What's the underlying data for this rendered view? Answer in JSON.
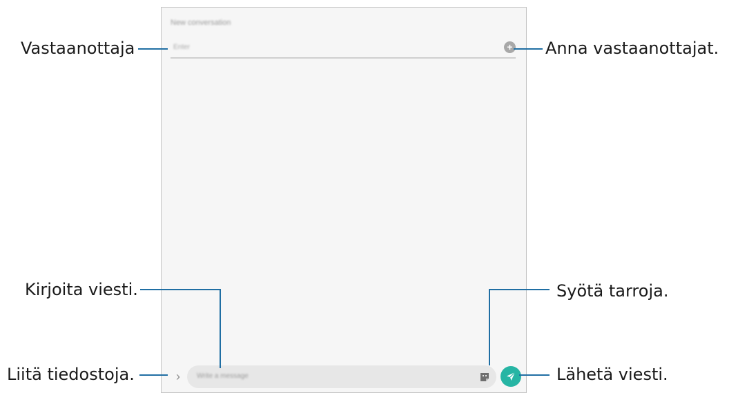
{
  "screen": {
    "title": "New conversation",
    "recipient_placeholder": "Enter",
    "message_placeholder": "Write a message",
    "send_button_color": "#27b5a4",
    "add_recipient_icon": "add-circle-icon",
    "attach_icon": "chevron-right-icon",
    "sticker_icon": "sticker-icon",
    "send_icon": "paper-plane-icon"
  },
  "callouts": {
    "recipient": "Vastaanottaja",
    "enter_recipients": "Anna vastaanottajat.",
    "write_message": "Kirjoita viesti.",
    "insert_stickers": "Syötä tarroja.",
    "attach_files": "Liitä tiedostoja.",
    "send_message": "Lähetä viesti."
  },
  "leader_color": "#1f6ea3"
}
